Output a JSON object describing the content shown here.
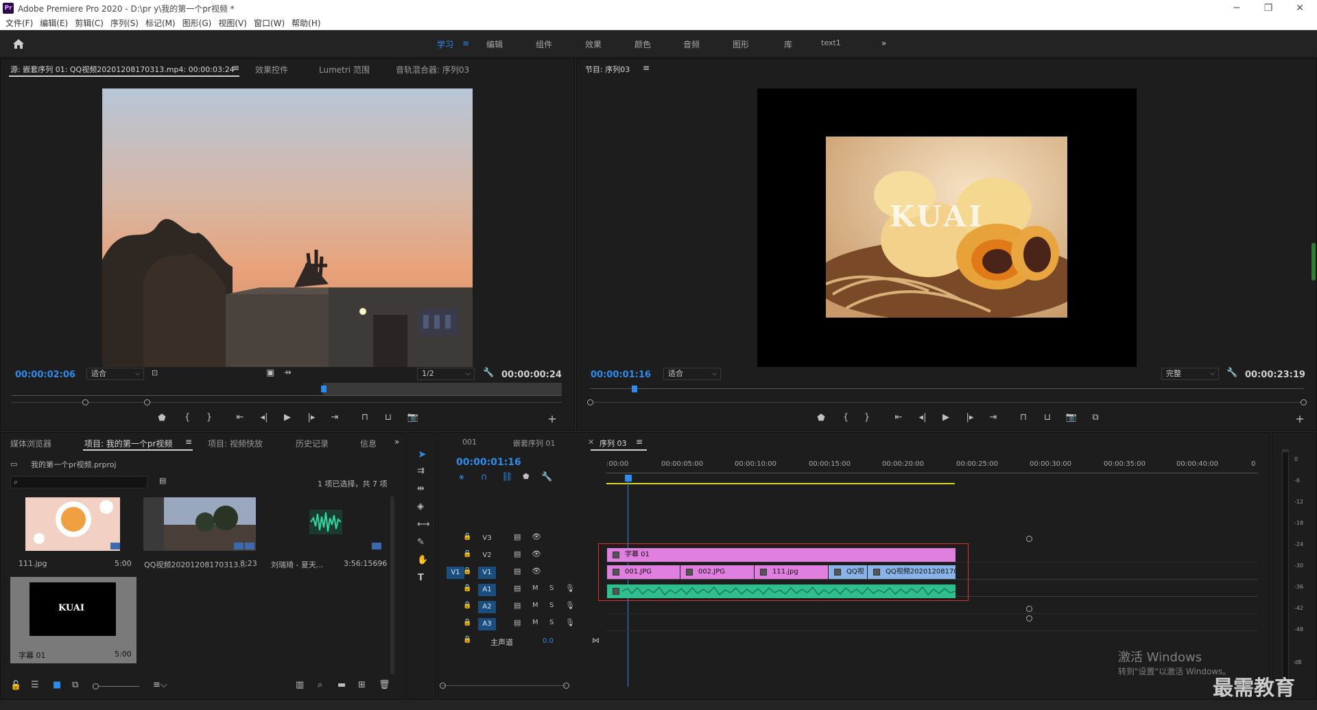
{
  "app": {
    "logo": "Pr",
    "title": "Adobe Premiere Pro 2020 - D:\\pr y\\我的第一个pr视频 *"
  },
  "menu": [
    "文件(F)",
    "编辑(E)",
    "剪辑(C)",
    "序列(S)",
    "标记(M)",
    "图形(G)",
    "视图(V)",
    "窗口(W)",
    "帮助(H)"
  ],
  "workspaces": {
    "items": [
      "学习",
      "编辑",
      "组件",
      "效果",
      "颜色",
      "音频",
      "图形",
      "库",
      "text1"
    ],
    "active": "学习",
    "more": "»"
  },
  "source_panel": {
    "tabs": [
      "源: 嵌套序列 01: QQ视频20201208170313.mp4: 00:00:03:24",
      "效果控件",
      "Lumetri 范围",
      "音轨混合器: 序列03"
    ],
    "timecode": "00:00:02:06",
    "fit": "适合",
    "resolution": "1/2",
    "duration": "00:00:00:24"
  },
  "program_panel": {
    "tab": "节目: 序列03",
    "timecode": "00:00:01:16",
    "fit": "适合",
    "quality": "完整",
    "duration": "00:00:23:19",
    "overlay_text": "KUAI"
  },
  "project_panel": {
    "tabs": [
      "媒体浏览器",
      "项目: 我的第一个pr视频",
      "项目: 视频快放",
      "历史记录",
      "信息"
    ],
    "project_file": "我的第一个pr视频.prproj",
    "search_placeholder": "",
    "selection_info": "1 项已选择，共 7 项",
    "items": [
      {
        "name": "111.jpg",
        "duration": "5:00"
      },
      {
        "name": "QQ视频20201208170313...",
        "duration": "8;23"
      },
      {
        "name": "刘瑞琦 - 夏天...",
        "duration": "3:56:15696"
      },
      {
        "name": "字幕 01",
        "duration": "5:00",
        "thumb_text": "KUAI"
      }
    ]
  },
  "timeline_panel": {
    "tabs": [
      "001",
      "嵌套序列 01",
      "序列 03"
    ],
    "timecode": "00:00:01:16",
    "ruler_labels": [
      ":00:00",
      "00:00:05:00",
      "00:00:10:00",
      "00:00:15:00",
      "00:00:20:00",
      "00:00:25:00",
      "00:00:30:00",
      "00:00:35:00",
      "00:00:40:00",
      "0"
    ],
    "video_tracks": [
      "V3",
      "V2",
      "V1"
    ],
    "audio_tracks": [
      "A1",
      "A2",
      "A3"
    ],
    "source_patch_v": "V1",
    "master": {
      "label": "主声道",
      "value": "0.0"
    },
    "track_buttons": {
      "mute": "M",
      "solo": "S"
    },
    "clips": {
      "v2": "字幕 01",
      "v1": [
        "001.JPG",
        "002.JPG",
        "111.jpg",
        "QQ视",
        "QQ视频202012081703"
      ]
    }
  },
  "meter_labels": [
    "0",
    "-6",
    "-12",
    "-18",
    "-24",
    "-30",
    "-36",
    "-42",
    "-48",
    "dB"
  ],
  "watermark": {
    "line1": "激活 Windows",
    "line2": "转到\"设置\"以激活 Windows。",
    "brand": "最需教育"
  },
  "colors": {
    "accent": "#2d8ceb",
    "clip_pink": "#e07fe0",
    "clip_blue": "#8ab4e8",
    "clip_audio": "#2fbf8f",
    "selection_box": "#e03030",
    "work_area": "#d8d81f"
  }
}
